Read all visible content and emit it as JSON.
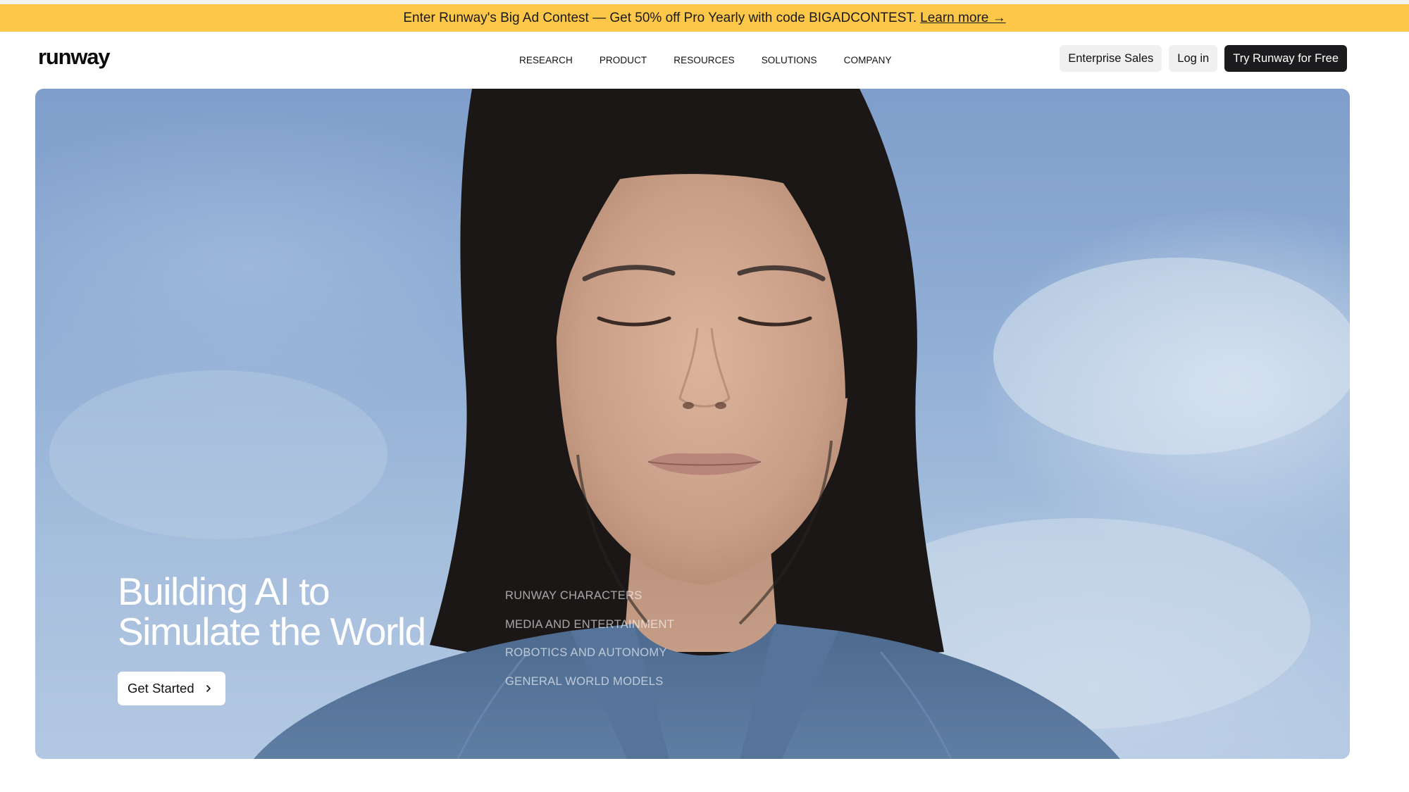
{
  "announcement": {
    "text": "Enter Runway's Big Ad Contest — Get 50% off Pro Yearly with code BIGADCONTEST.",
    "link": "Learn more →"
  },
  "nav": {
    "logo": "runway",
    "links": [
      "RESEARCH",
      "PRODUCT",
      "RESOURCES",
      "SOLUTIONS",
      "COMPANY"
    ],
    "enterprise": "Enterprise Sales",
    "login": "Log in",
    "cta": "Try Runway for Free"
  },
  "hero": {
    "title_line1": "Building AI to",
    "title_line2": "Simulate the World",
    "button": "Get Started",
    "solutions": [
      "RUNWAY CHARACTERS",
      "MEDIA AND ENTERTAINMENT",
      "ROBOTICS AND AUTONOMY",
      "GENERAL WORLD MODELS"
    ]
  },
  "colors": {
    "banner": "#fdc84a",
    "cta_dark": "#1c1c1e",
    "sky": "#8fadd4"
  }
}
